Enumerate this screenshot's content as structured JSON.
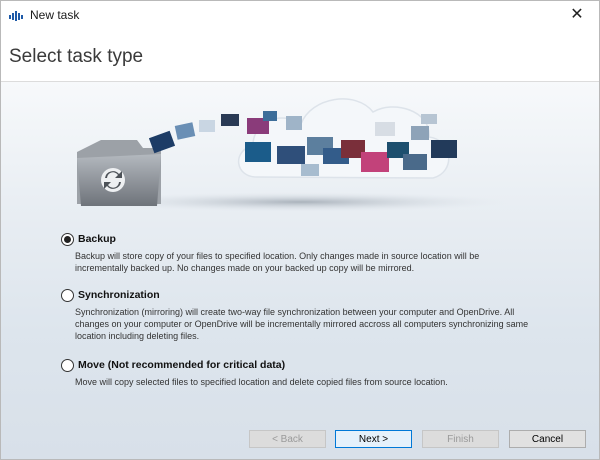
{
  "window": {
    "title": "New task",
    "icons": {
      "app": "opendrive-logo-icon",
      "close": "close-icon"
    }
  },
  "header": {
    "title": "Select task type"
  },
  "banner": {
    "image": "folder-to-cloud-illustration"
  },
  "options": [
    {
      "label": "Backup",
      "selected": true,
      "desc": [
        "Backup will store copy of your files to specified location. Only changes made in source location will be",
        "incrementally backed up. No changes made on your backed up copy will be mirrored."
      ]
    },
    {
      "label": "Synchronization",
      "selected": false,
      "desc": [
        "Synchronization (mirroring) will create two-way file synchronization between your computer and OpenDrive. All",
        "changes on your computer or OpenDrive will be incrementally mirrored accross all computers synchronizing same",
        "location including deleting files."
      ]
    },
    {
      "label": "Move (Not recommended for critical data)",
      "selected": false,
      "desc": [
        "Move will copy selected files to specified location and delete copied files from source location."
      ]
    }
  ],
  "buttons": {
    "back": "< Back",
    "next": "Next >",
    "finish": "Finish",
    "cancel": "Cancel"
  },
  "colors": {
    "accent": "#0078d7",
    "folder": "#8a8f96",
    "background": "#e2e8ef"
  }
}
